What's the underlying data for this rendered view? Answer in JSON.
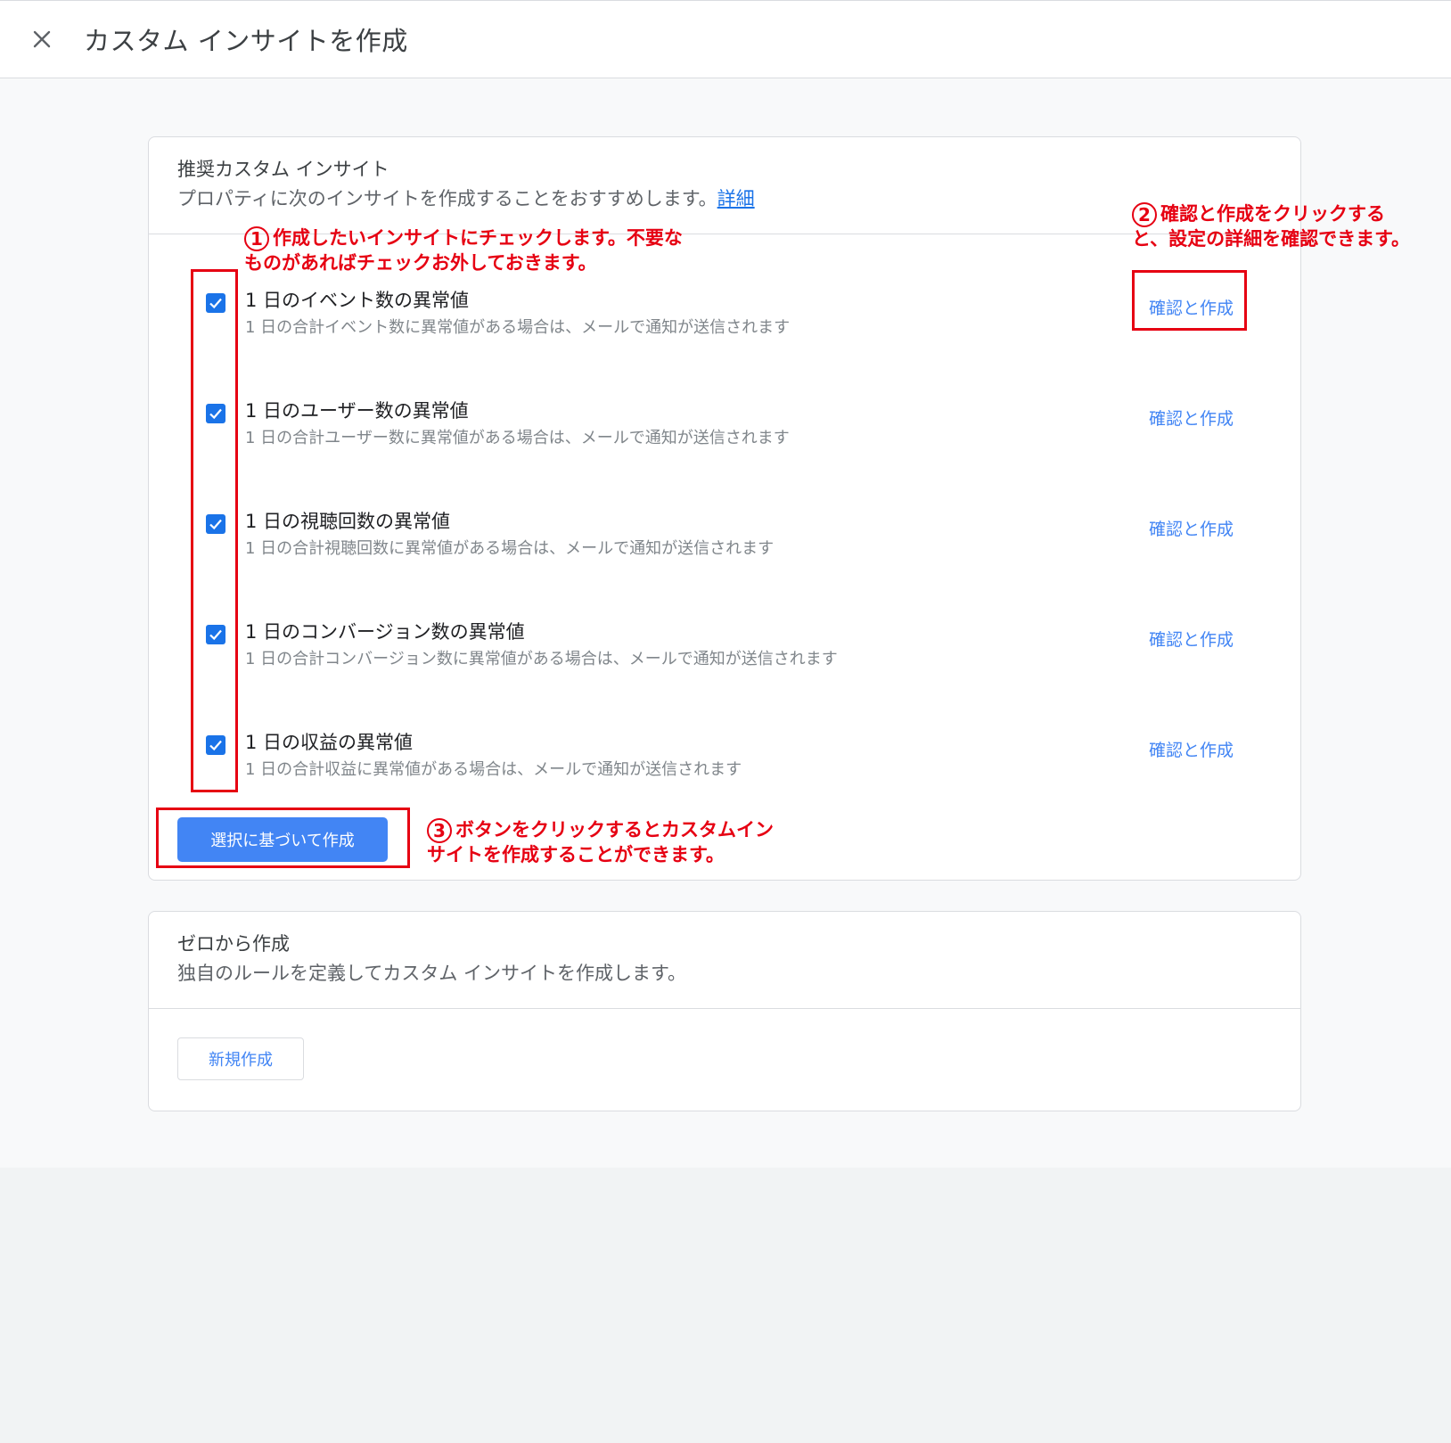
{
  "header": {
    "title": "カスタム インサイトを作成",
    "close_icon": "close-icon"
  },
  "recommended": {
    "title": "推奨カスタム インサイト",
    "subtitle": "プロパティに次のインサイトを作成することをおすすめします。",
    "detail_link": "詳細",
    "items": [
      {
        "title": "1 日のイベント数の異常値",
        "desc": "1 日の合計イベント数に異常値がある場合は、メールで通知が送信されます",
        "action": "確認と作成",
        "checked": true
      },
      {
        "title": "1 日のユーザー数の異常値",
        "desc": "1 日の合計ユーザー数に異常値がある場合は、メールで通知が送信されます",
        "action": "確認と作成",
        "checked": true
      },
      {
        "title": "1 日の視聴回数の異常値",
        "desc": "1 日の合計視聴回数に異常値がある場合は、メールで通知が送信されます",
        "action": "確認と作成",
        "checked": true
      },
      {
        "title": "1 日のコンバージョン数の異常値",
        "desc": "1 日の合計コンバージョン数に異常値がある場合は、メールで通知が送信されます",
        "action": "確認と作成",
        "checked": true
      },
      {
        "title": "1 日の収益の異常値",
        "desc": "1 日の合計収益に異常値がある場合は、メールで通知が送信されます",
        "action": "確認と作成",
        "checked": true
      }
    ],
    "create_button": "選択に基づいて作成"
  },
  "scratch": {
    "title": "ゼロから作成",
    "subtitle": "独自のルールを定義してカスタム インサイトを作成します。",
    "new_button": "新規作成"
  },
  "annotations": {
    "a1": {
      "num": "1",
      "line1": "作成したいインサイトにチェックします。不要な",
      "line2": "ものがあればチェックお外しておきます。"
    },
    "a2": {
      "num": "2",
      "line1": "確認と作成をクリックする",
      "line2": "と、設定の詳細を確認できます。"
    },
    "a3": {
      "num": "3",
      "line1": "ボタンをクリックするとカスタムイン",
      "line2": "サイトを作成することができます。"
    }
  },
  "colors": {
    "accent": "#1a73e8",
    "button": "#4285f4",
    "annotation": "#e60012"
  }
}
